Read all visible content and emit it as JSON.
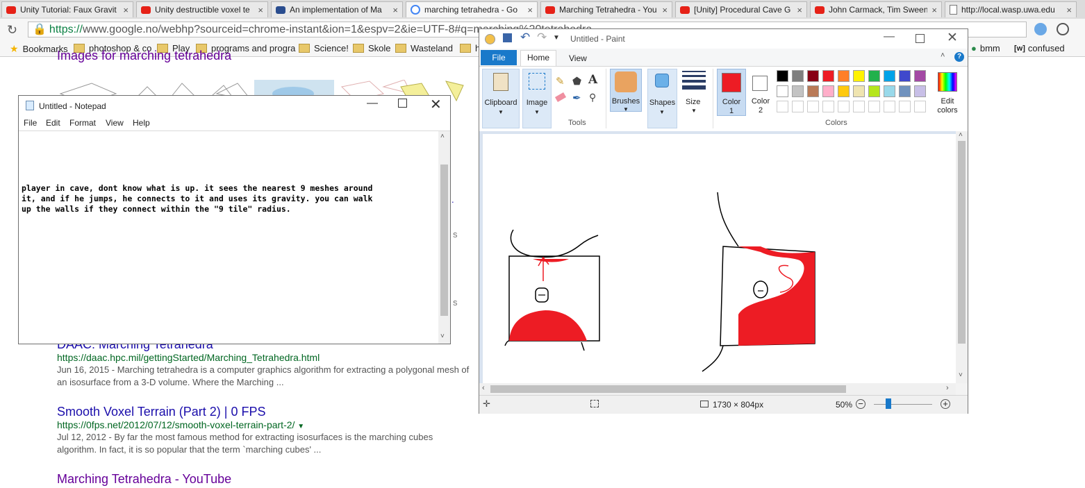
{
  "browser": {
    "tabs": [
      {
        "label": "Unity Tutorial: Faux Gravit",
        "icon": "youtube-icon"
      },
      {
        "label": "Unity destructible voxel te",
        "icon": "youtube-icon"
      },
      {
        "label": "An implementation of Ma",
        "icon": "image-icon"
      },
      {
        "label": "marching tetrahedra - Go",
        "icon": "google-icon"
      },
      {
        "label": "Marching Tetrahedra - You",
        "icon": "youtube-icon"
      },
      {
        "label": "[Unity] Procedural Cave G",
        "icon": "youtube-icon"
      },
      {
        "label": "John Carmack, Tim Sween",
        "icon": "youtube-icon"
      },
      {
        "label": "http://local.wasp.uwa.edu",
        "icon": "page-icon"
      }
    ],
    "url_https": "https://",
    "url_rest": "www.google.no/webhp?sourceid=chrome-instant&ion=1&espv=2&ie=UTF-8#q=marching%20tetrahedra",
    "bookmarks": [
      {
        "label": "Bookmarks",
        "icon": "star-icon"
      },
      {
        "label": "photoshop & co",
        "icon": "folder-icon"
      },
      {
        "label": "Play",
        "icon": "folder-icon"
      },
      {
        "label": "programs and progra",
        "icon": "folder-icon"
      },
      {
        "label": "Science!",
        "icon": "folder-icon"
      },
      {
        "label": "Skole",
        "icon": "folder-icon"
      },
      {
        "label": "Wasteland",
        "icon": "folder-icon"
      },
      {
        "label": "ha",
        "icon": "folder-icon"
      },
      {
        "label": "bmm",
        "icon": "page-icon"
      },
      {
        "label": "confused",
        "icon": "wiki-icon"
      }
    ]
  },
  "google": {
    "images_heading": "Images for marching tetrahedra",
    "results": [
      {
        "title": "DAAC: Marching Tetrahedra",
        "url": "https://daac.hpc.mil/gettingStarted/Marching_Tetrahedra.html",
        "snippet": "Jun 16, 2015 - Marching tetrahedra is a computer graphics algorithm for extracting a polygonal mesh of an isosurface from a 3-D volume. Where the Marching ..."
      },
      {
        "title": "Smooth Voxel Terrain (Part 2) | 0 FPS",
        "url": "https://0fps.net/2012/07/12/smooth-voxel-terrain-part-2/",
        "snippet": "Jul 12, 2012 - By far the most famous method for extracting isosurfaces is the marching cubes algorithm. In fact, it is so popular that the term `marching cubes' ..."
      },
      {
        "title": "Marching Tetrahedra - YouTube"
      }
    ]
  },
  "notepad": {
    "title": "Untitled - Notepad",
    "menu": [
      "File",
      "Edit",
      "Format",
      "View",
      "Help"
    ],
    "text": "player in cave, dont know what is up. it sees the nearest 9 meshes around\nit, and if he jumps, he connects to it and uses its gravity. you can walk\nup the walls if they connect within the \"9 tile\" radius."
  },
  "paint": {
    "title": "Untitled - Paint",
    "tabs": [
      "File",
      "Home",
      "View"
    ],
    "groups": {
      "clipboard": "Clipboard",
      "image": "Image",
      "tools": "Tools",
      "brushes": "Brushes",
      "shapes": "Shapes",
      "size": "Size",
      "color1": "Color",
      "color1_num": "1",
      "color2": "Color",
      "color2_num": "2",
      "colors": "Colors",
      "edit_colors": "Edit",
      "edit_colors2": "colors"
    },
    "palette": [
      "#000000",
      "#7f7f7f",
      "#880015",
      "#ed1c24",
      "#ff7f27",
      "#fff200",
      "#22b14c",
      "#00a2e8",
      "#3f48cc",
      "#a349a4",
      "#ffffff",
      "#c3c3c3",
      "#b97a57",
      "#ffaec9",
      "#ffc90e",
      "#efe4b0",
      "#b5e61d",
      "#99d9ea",
      "#7092be",
      "#c8bfe7"
    ],
    "color1": "#ed1c24",
    "color2": "#ffffff",
    "status": {
      "canvas_size": "1730 × 804px",
      "zoom": "50%"
    }
  }
}
